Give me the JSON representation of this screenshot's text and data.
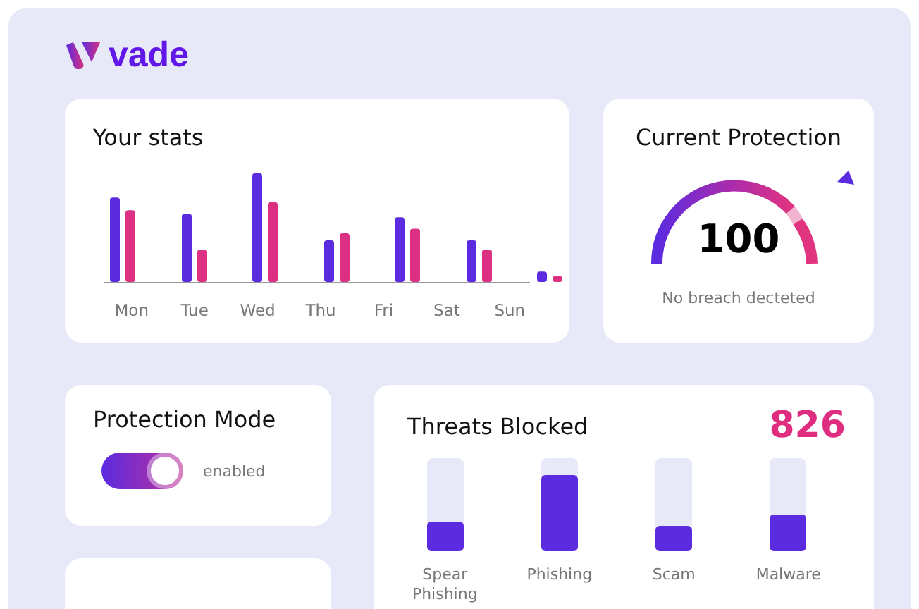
{
  "brand": {
    "name": "vade"
  },
  "stats": {
    "title": "Your stats",
    "days": [
      "Mon",
      "Tue",
      "Wed",
      "Thu",
      "Fri",
      "Sat",
      "Sun"
    ]
  },
  "protection": {
    "title": "Current Protection",
    "score": "100",
    "caption": "No breach decteted"
  },
  "mode": {
    "title": "Protection Mode",
    "on": true,
    "label": "enabled"
  },
  "threats": {
    "title": "Threats Blocked",
    "total": "826",
    "items": [
      {
        "label": "Spear Phishing",
        "level": 0.32
      },
      {
        "label": "Phishing",
        "level": 0.82
      },
      {
        "label": "Scam",
        "level": 0.28
      },
      {
        "label": "Malware",
        "level": 0.39
      }
    ]
  }
}
